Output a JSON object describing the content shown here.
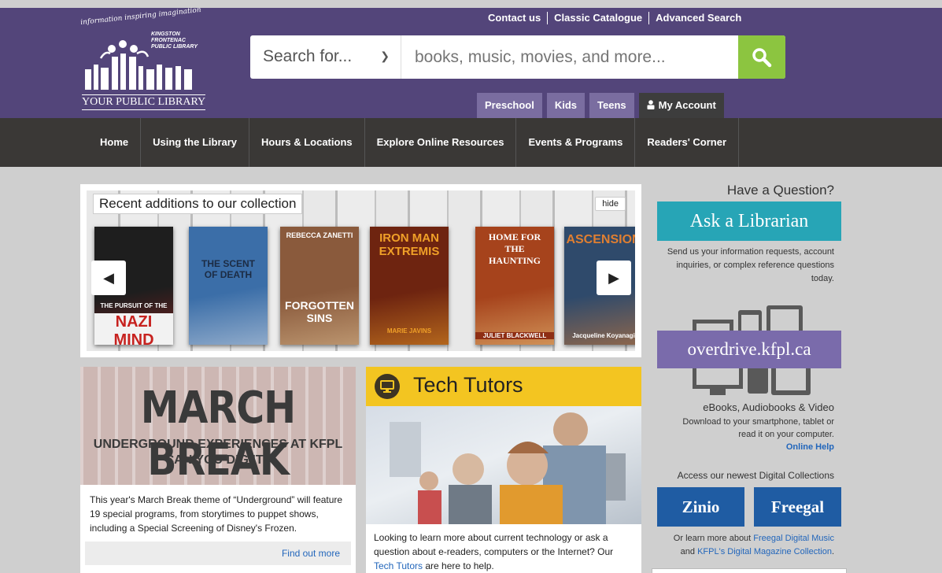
{
  "logo": {
    "tagline": "information inspiring imagination",
    "org_name": "KINGSTON FRONTENAC PUBLIC LIBRARY",
    "your_library": "YOUR PUBLIC LIBRARY"
  },
  "top_links": [
    "Contact us",
    "Classic Catalogue",
    "Advanced Search"
  ],
  "search": {
    "scope_label": "Search for...",
    "placeholder": "books, music, movies, and more..."
  },
  "audience_tabs": [
    "Preschool",
    "Kids",
    "Teens"
  ],
  "my_account": "My Account",
  "nav": [
    "Home",
    "Using the Library",
    "Hours & Locations",
    "Explore Online Resources",
    "Events & Programs",
    "Readers' Corner"
  ],
  "carousel": {
    "title": "Recent additions to our collection",
    "hide_label": "hide",
    "books": [
      {
        "title": "NAZI MIND",
        "subtitle": "THE PURSUIT OF THE",
        "colors": {
          "bg": "#1e1e1e",
          "accent": "#c7221f"
        }
      },
      {
        "title": "THE SCENT OF DEATH",
        "subtitle": "",
        "colors": {
          "bg": "#3b6ea8",
          "accent": "#d9dfe8"
        }
      },
      {
        "title": "FORGOTTEN SINS",
        "subtitle": "REBECCA ZANETTI",
        "colors": {
          "bg": "#8a5a3c",
          "accent": "#e6c89b"
        }
      },
      {
        "title": "IRON MAN EXTREMIS",
        "subtitle": "MARIE JAVINS",
        "colors": {
          "bg": "#6e2410",
          "accent": "#f0a028"
        }
      },
      {
        "title": "HOME FOR THE HAUNTING",
        "subtitle": "JULIET BLACKWELL",
        "colors": {
          "bg": "#a6431c",
          "accent": "#f5d58a"
        }
      },
      {
        "title": "ASCENSION",
        "subtitle": "Jacqueline Koyanagi",
        "colors": {
          "bg": "#2f4a6b",
          "accent": "#e07f31"
        }
      }
    ]
  },
  "march_break": {
    "title": "MARCH BREAK",
    "sub1": "UNDERGROUND EXPERIENCES AT KFPL",
    "sub2": "CAN YOU DIG IT?",
    "text": "This year's March Break theme of “Underground” will feature 19 special programs, from storytimes to puppet shows, including a Special Screening of Disney's Frozen.",
    "link": "Find out more"
  },
  "tech_tutors": {
    "title": "Tech Tutors",
    "text_before": "Looking to learn more about current technology or ask a question about e-readers, computers or the Internet? Our ",
    "link": "Tech Tutors",
    "text_after": " are here to help."
  },
  "sidebar": {
    "question": "Have a Question?",
    "ask_button": "Ask a Librarian",
    "ask_desc": "Send us your information requests, account inquiries, or complex reference questions today.",
    "overdrive_button": "overdrive.kfpl.ca",
    "ebooks_title": "eBooks, Audiobooks & Video",
    "ebooks_desc": "Download to your smartphone, tablet or read it on your computer.",
    "online_help": "Online Help",
    "access_text": "Access our newest Digital Collections",
    "zinio": "Zinio",
    "freegal": "Freegal",
    "more_prefix": "Or learn more about ",
    "freegal_link": "Freegal Digital Music",
    "more_mid": " and ",
    "magazine_link": "KFPL's Digital Magazine Collection",
    "more_suffix": "."
  },
  "colors": {
    "header": "#53457a",
    "nav": "#3a3836",
    "search_button": "#8cc540",
    "ask": "#27a5b6",
    "overdrive": "#7a6bab",
    "collections": "#1f5ca3",
    "tech_yellow": "#f3c521"
  }
}
